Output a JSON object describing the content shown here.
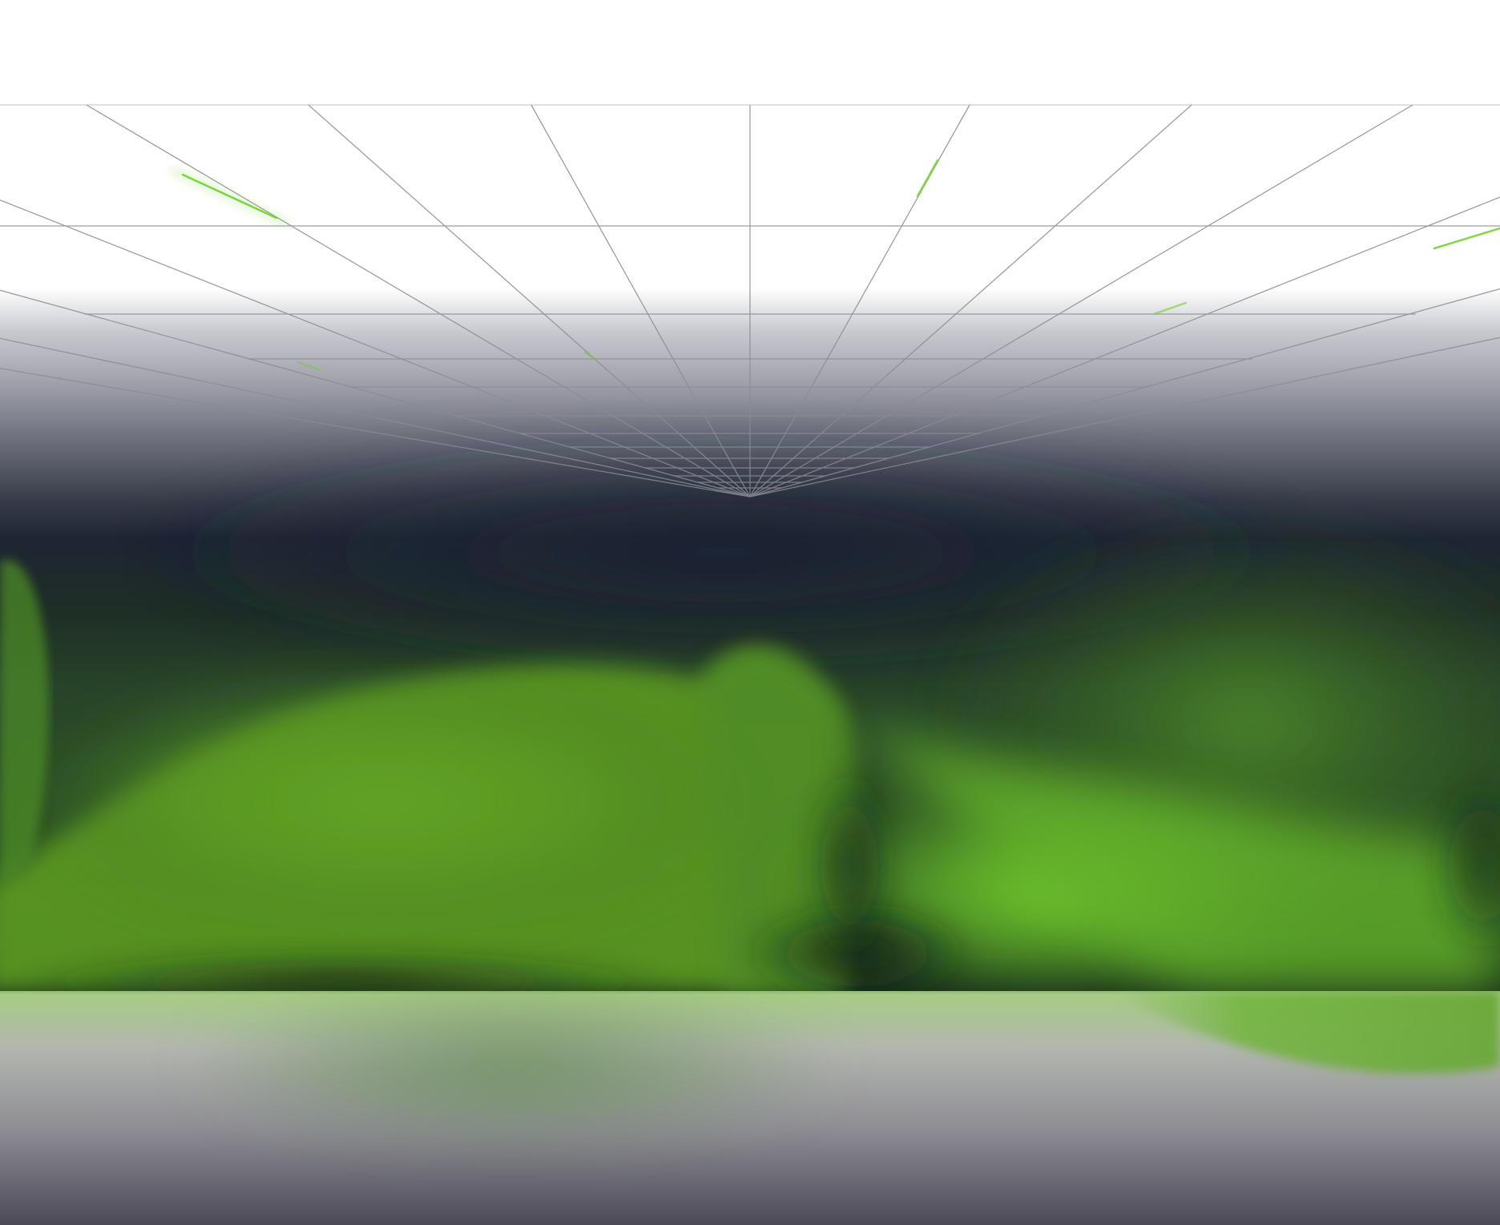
{
  "scene": {
    "title": "",
    "colors": {
      "background": "#ffffff",
      "grid_line": "#8a8c94",
      "grid_glint": "#6fd02a",
      "dark_navy": "#1c2331",
      "deep_green": "#173319",
      "mid_green": "#5b9a22",
      "bright_green": "#73cc2a",
      "floor_gray": "#b5b6b8",
      "floor_dark": "#4a4856",
      "reflection_green": "#8cc860"
    }
  }
}
